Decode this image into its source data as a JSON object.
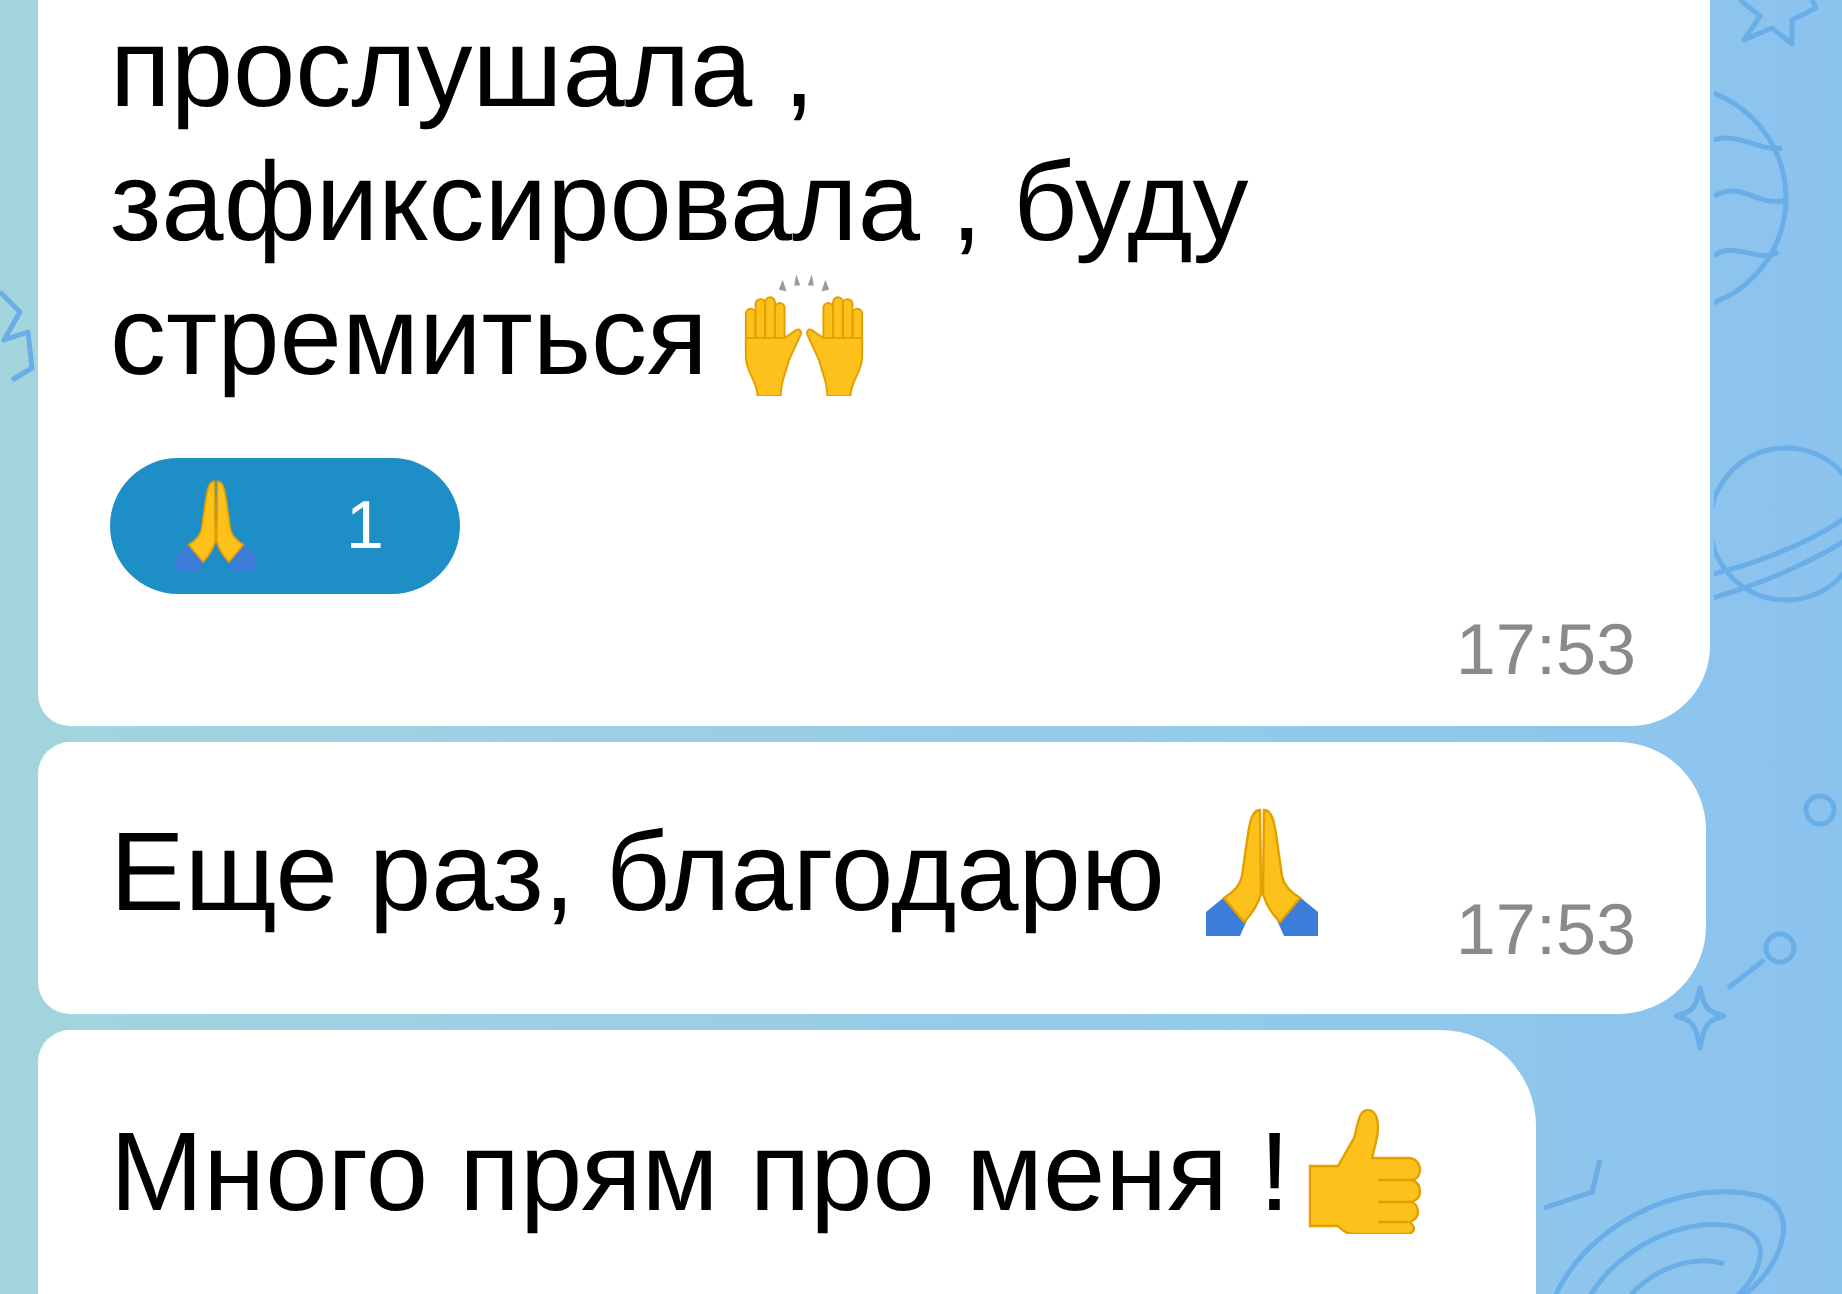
{
  "messages": [
    {
      "text": "прослушала , зафиксировала , буду стремиться",
      "reactions": [
        {
          "count": "1",
          "selected": true
        }
      ],
      "time": "17:53"
    },
    {
      "text": "Еще раз, благодарю",
      "time": "17:53"
    },
    {
      "text": "Много прям про меня !"
    }
  ]
}
